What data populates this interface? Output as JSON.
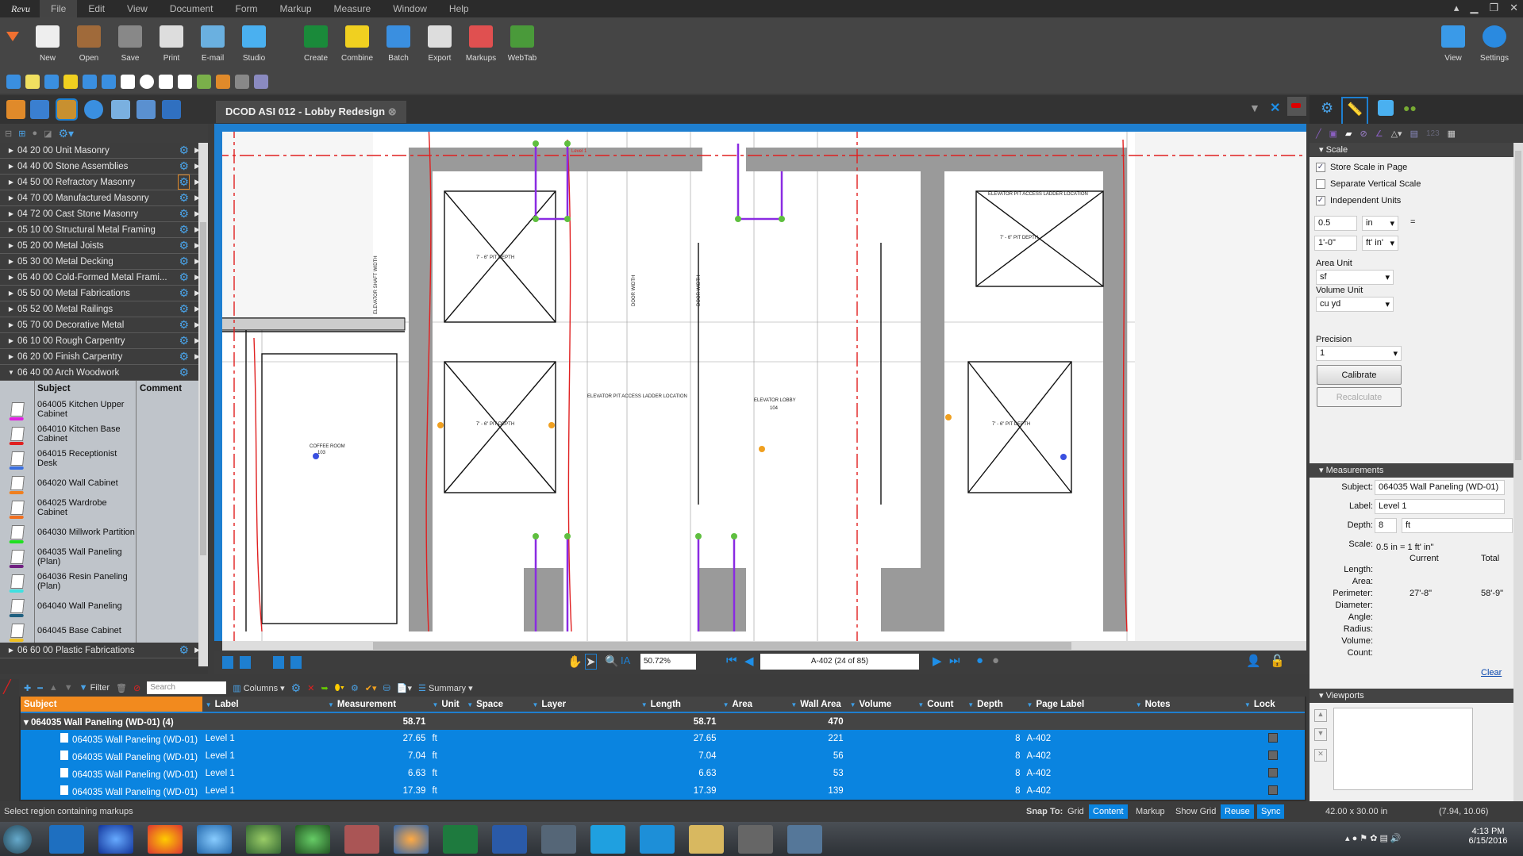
{
  "app": {
    "logo": "Revu",
    "menu": [
      "File",
      "Edit",
      "View",
      "Document",
      "Form",
      "Markup",
      "Measure",
      "Window",
      "Help"
    ],
    "active_menu": "File"
  },
  "toolbar": {
    "buttons": [
      {
        "label": "New",
        "icon": "new-document-icon"
      },
      {
        "label": "Open",
        "icon": "folder-icon"
      },
      {
        "label": "Save",
        "icon": "floppy-icon"
      },
      {
        "label": "Print",
        "icon": "printer-icon"
      },
      {
        "label": "E-mail",
        "icon": "envelope-icon"
      },
      {
        "label": "Studio",
        "icon": "studio-icon"
      },
      {
        "label": "Create",
        "icon": "create-icon"
      },
      {
        "label": "Combine",
        "icon": "combine-icon"
      },
      {
        "label": "Batch",
        "icon": "batch-icon"
      },
      {
        "label": "Export",
        "icon": "export-icon"
      },
      {
        "label": "Markups",
        "icon": "markups-icon"
      },
      {
        "label": "WebTab",
        "icon": "globe-icon"
      }
    ],
    "right": [
      {
        "label": "View",
        "icon": "monitor-icon"
      },
      {
        "label": "Settings",
        "icon": "revu-icon"
      }
    ]
  },
  "document_tab": {
    "title": "DCOD ASI 012 - Lobby Redesign"
  },
  "tool_chest": {
    "groups": [
      "04 20 00 Unit Masonry",
      "04 40 00 Stone Assemblies",
      "04 50 00 Refractory Masonry",
      "04 70 00 Manufactured Masonry",
      "04 72 00 Cast Stone Masonry",
      "05 10 00 Structural Metal Framing",
      "05 20 00 Metal Joists",
      "05 30 00 Metal Decking",
      "05 40 00 Cold-Formed Metal Frami...",
      "05 50 00 Metal Fabrications",
      "05 52 00 Metal Railings",
      "05 70 00 Decorative Metal",
      "06 10 00 Rough Carpentry",
      "06 20 00 Finish Carpentry"
    ],
    "expanded_group": "06 40 00 Arch Woodwork",
    "columns": {
      "subject": "Subject",
      "comment": "Comment"
    },
    "items": [
      {
        "subject": "064005 Kitchen Upper Cabinet",
        "color": "#e020e0"
      },
      {
        "subject": "064010 Kitchen Base Cabinet",
        "color": "#e02020"
      },
      {
        "subject": "064015 Receptionist Desk",
        "color": "#3a6fe0"
      },
      {
        "subject": "064020 Wall Cabinet",
        "color": "#f08020"
      },
      {
        "subject": "064025 Wardrobe Cabinet",
        "color": "#f07020"
      },
      {
        "subject": "064030 Millwork Partition",
        "color": "#20e020"
      },
      {
        "subject": "064035 Wall Paneling (Plan)",
        "color": "#702080"
      },
      {
        "subject": "064036 Resin Paneling (Plan)",
        "color": "#40e0e0"
      },
      {
        "subject": "064040 Wall Paneling",
        "color": "#206080"
      },
      {
        "subject": "064045 Base Cabinet",
        "color": "#f0c020"
      }
    ],
    "next_group": "06 60 00 Plastic Fabrications"
  },
  "drawing": {
    "labels": [
      "7' - 6\" PIT DEPTH",
      "ELEVATOR PIT ACCESS LADDER LOCATION",
      "ELEVATOR LOBBY",
      "104",
      "DOOR WIDTH",
      "ELEVATOR SHAFT WIDTH",
      "COFFEE ROOM",
      "103",
      "Level 1"
    ]
  },
  "navigation": {
    "zoom": "50.72%",
    "page": "A-402 (24 of 85)"
  },
  "markups_list": {
    "toolbar": {
      "filter": "Filter",
      "search_placeholder": "Search",
      "columns": "Columns",
      "summary": "Summary"
    },
    "columns": [
      "Subject",
      "Label",
      "Measurement",
      "Unit",
      "Space",
      "Layer",
      "Length",
      "Area",
      "Wall Area",
      "Volume",
      "Count",
      "Depth",
      "Page Label",
      "Notes",
      "Lock"
    ],
    "group": {
      "subject": "064035 Wall Paneling (WD-01) (4)",
      "measurement": "58.71",
      "length": "58.71",
      "wall_area": "470"
    },
    "rows": [
      {
        "subject": "064035 Wall Paneling (WD-01)",
        "label": "Level 1",
        "measurement": "27.65",
        "unit": "ft",
        "length": "27.65",
        "wall_area": "221",
        "depth": "8",
        "page_label": "A-402"
      },
      {
        "subject": "064035 Wall Paneling (WD-01)",
        "label": "Level 1",
        "measurement": "7.04",
        "unit": "ft",
        "length": "7.04",
        "wall_area": "56",
        "depth": "8",
        "page_label": "A-402"
      },
      {
        "subject": "064035 Wall Paneling (WD-01)",
        "label": "Level 1",
        "measurement": "6.63",
        "unit": "ft",
        "length": "6.63",
        "wall_area": "53",
        "depth": "8",
        "page_label": "A-402"
      },
      {
        "subject": "064035 Wall Paneling (WD-01)",
        "label": "Level 1",
        "measurement": "17.39",
        "unit": "ft",
        "length": "17.39",
        "wall_area": "139",
        "depth": "8",
        "page_label": "A-402"
      }
    ]
  },
  "properties": {
    "scale": {
      "title": "Scale",
      "store_scale": {
        "label": "Store Scale in Page",
        "checked": true
      },
      "separate_vertical": {
        "label": "Separate Vertical Scale",
        "checked": false
      },
      "independent_units": {
        "label": "Independent Units",
        "checked": true
      },
      "value1": "0.5",
      "unit1": "in",
      "equals": "=",
      "value2": "1'-0\"",
      "unit2": "ft' in'",
      "area_unit_label": "Area Unit",
      "area_unit": "sf",
      "volume_unit_label": "Volume Unit",
      "volume_unit": "cu yd",
      "precision_label": "Precision",
      "precision": "1",
      "calibrate": "Calibrate",
      "recalculate": "Recalculate"
    },
    "measurements": {
      "title": "Measurements",
      "subject_label": "Subject:",
      "subject": "064035 Wall Paneling (WD-01)",
      "label_label": "Label:",
      "label": "Level 1",
      "depth_label": "Depth:",
      "depth": "8",
      "depth_unit": "ft",
      "scale_label": "Scale:",
      "scale": "0.5 in = 1 ft' in\"",
      "current": "Current",
      "total": "Total",
      "rows": [
        {
          "name": "Length:",
          "current": "",
          "total": ""
        },
        {
          "name": "Area:",
          "current": "",
          "total": ""
        },
        {
          "name": "Perimeter:",
          "current": "27'-8\"",
          "total": "58'-9\""
        },
        {
          "name": "Diameter:",
          "current": "",
          "total": ""
        },
        {
          "name": "Angle:",
          "current": "",
          "total": ""
        },
        {
          "name": "Radius:",
          "current": "",
          "total": ""
        },
        {
          "name": "Volume:",
          "current": "",
          "total": ""
        },
        {
          "name": "Count:",
          "current": "",
          "total": ""
        }
      ],
      "clear": "Clear"
    },
    "viewports": {
      "title": "Viewports"
    }
  },
  "status": {
    "message": "Select region containing markups",
    "snap_to": "Snap To:",
    "toggles": [
      {
        "label": "Grid",
        "on": false
      },
      {
        "label": "Content",
        "on": true
      },
      {
        "label": "Markup",
        "on": false
      },
      {
        "label": "Show Grid",
        "on": false
      },
      {
        "label": "Reuse",
        "on": true
      },
      {
        "label": "Sync",
        "on": true
      }
    ],
    "page_size": "42.00 x 30.00 in",
    "cursor": "(7.94, 10.06)"
  },
  "taskbar": {
    "time": "4:13 PM",
    "date": "6/15/2016"
  },
  "colors": {
    "accent": "#0a84e0",
    "header_orange": "#f28a1e",
    "markup_red": "#e02020",
    "markup_purple": "#8a2be2"
  }
}
